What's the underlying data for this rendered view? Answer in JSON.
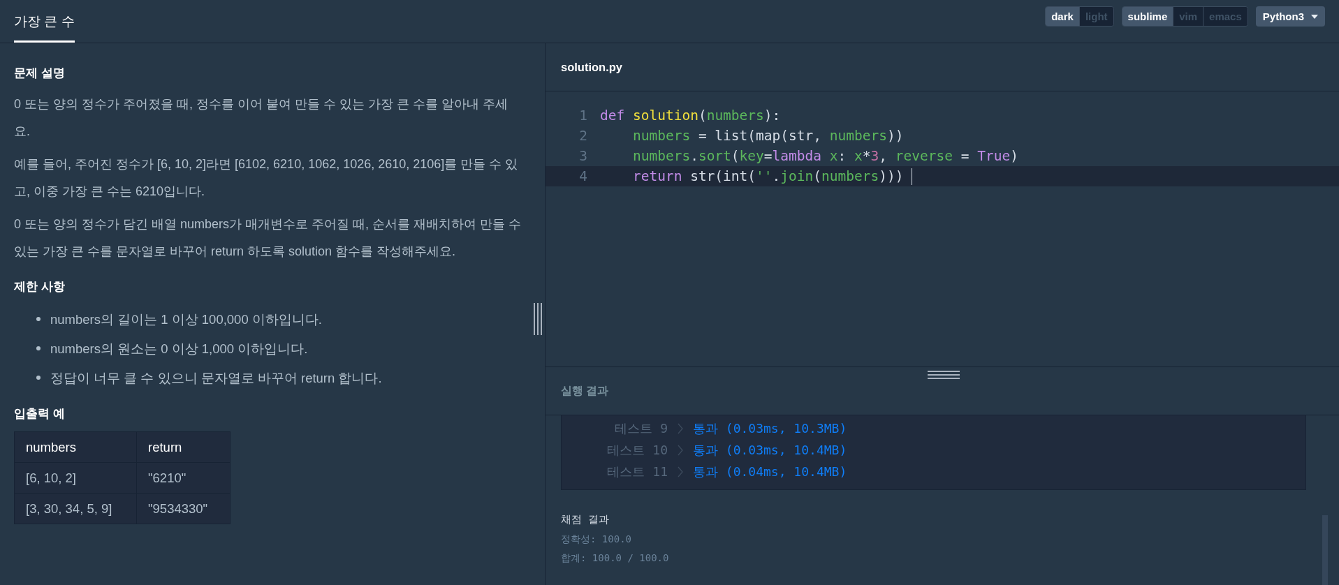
{
  "header": {
    "tabs": [
      {
        "label": "가장 큰 수",
        "selected": true
      }
    ],
    "theme_toggle": [
      {
        "label": "dark",
        "selected": true
      },
      {
        "label": "light",
        "selected": false
      }
    ],
    "keymap_toggle": [
      {
        "label": "sublime",
        "selected": true
      },
      {
        "label": "vim",
        "selected": false
      },
      {
        "label": "emacs",
        "selected": false
      }
    ],
    "language_dropdown": {
      "label": "Python3"
    }
  },
  "problem": {
    "sections": [
      {
        "title": "문제 설명",
        "kind": "paragraphs",
        "items": [
          "0 또는 양의 정수가 주어졌을 때, 정수를 이어 붙여 만들 수 있는 가장 큰 수를 알아내 주세요.",
          "예를 들어, 주어진 정수가 [6, 10, 2]라면 [6102, 6210, 1062, 1026, 2610, 2106]를 만들 수 있고, 이중 가장 큰 수는 6210입니다.",
          "0 또는 양의 정수가 담긴 배열 numbers가 매개변수로 주어질 때, 순서를 재배치하여 만들 수 있는 가장 큰 수를 문자열로 바꾸어 return 하도록 solution 함수를 작성해주세요."
        ]
      },
      {
        "title": "제한 사항",
        "kind": "bullets",
        "items": [
          "numbers의 길이는 1 이상 100,000 이하입니다.",
          "numbers의 원소는 0 이상 1,000 이하입니다.",
          "정답이 너무 클 수 있으니 문자열로 바꾸어 return 합니다."
        ]
      },
      {
        "title": "입출력 예",
        "kind": "table",
        "columns": [
          "numbers",
          "return"
        ],
        "rows": [
          [
            "[6, 10, 2]",
            "\"6210\""
          ],
          [
            "[3, 30, 34, 5, 9]",
            "\"9534330\""
          ]
        ]
      }
    ]
  },
  "editor": {
    "filename": "solution.py",
    "lines": [
      {
        "number": "1",
        "current": false,
        "tokens": [
          {
            "kind": "keyword",
            "text": "def "
          },
          {
            "kind": "function",
            "text": "solution"
          },
          {
            "kind": "plain",
            "text": "("
          },
          {
            "kind": "variable",
            "text": "numbers"
          },
          {
            "kind": "plain",
            "text": "):"
          }
        ]
      },
      {
        "number": "2",
        "current": false,
        "tokens": [
          {
            "kind": "variable",
            "text": "    numbers"
          },
          {
            "kind": "plain",
            "text": " = list(map(str, "
          },
          {
            "kind": "variable",
            "text": "numbers"
          },
          {
            "kind": "plain",
            "text": "))"
          }
        ]
      },
      {
        "number": "3",
        "current": false,
        "tokens": [
          {
            "kind": "variable",
            "text": "    numbers"
          },
          {
            "kind": "plain",
            "text": "."
          },
          {
            "kind": "variable",
            "text": "sort"
          },
          {
            "kind": "plain",
            "text": "("
          },
          {
            "kind": "variable",
            "text": "key"
          },
          {
            "kind": "plain",
            "text": "="
          },
          {
            "kind": "keyword",
            "text": "lambda "
          },
          {
            "kind": "variable",
            "text": "x"
          },
          {
            "kind": "plain",
            "text": ": "
          },
          {
            "kind": "variable",
            "text": "x"
          },
          {
            "kind": "plain",
            "text": "*"
          },
          {
            "kind": "number",
            "text": "3"
          },
          {
            "kind": "plain",
            "text": ", "
          },
          {
            "kind": "variable",
            "text": "reverse"
          },
          {
            "kind": "plain",
            "text": " = "
          },
          {
            "kind": "keyword",
            "text": "True"
          },
          {
            "kind": "plain",
            "text": ")"
          }
        ]
      },
      {
        "number": "4",
        "current": true,
        "tokens": [
          {
            "kind": "keyword",
            "text": "    return"
          },
          {
            "kind": "plain",
            "text": " str(int("
          },
          {
            "kind": "string",
            "text": "''"
          },
          {
            "kind": "plain",
            "text": "."
          },
          {
            "kind": "variable",
            "text": "join"
          },
          {
            "kind": "plain",
            "text": "("
          },
          {
            "kind": "variable",
            "text": "numbers"
          },
          {
            "kind": "plain",
            "text": ")))"
          }
        ]
      }
    ]
  },
  "run_result": {
    "title": "실행 결과",
    "tests": [
      {
        "label": "테스트 9",
        "status": "통과",
        "detail": "(0.03ms, 10.3MB)"
      },
      {
        "label": "테스트 10",
        "status": "통과",
        "detail": "(0.03ms, 10.4MB)"
      },
      {
        "label": "테스트 11",
        "status": "통과",
        "detail": "(0.04ms, 10.4MB)"
      }
    ],
    "grading": {
      "title": "채점 결과",
      "lines": [
        "정확성: 100.0",
        "합계: 100.0 / 100.0"
      ]
    }
  }
}
